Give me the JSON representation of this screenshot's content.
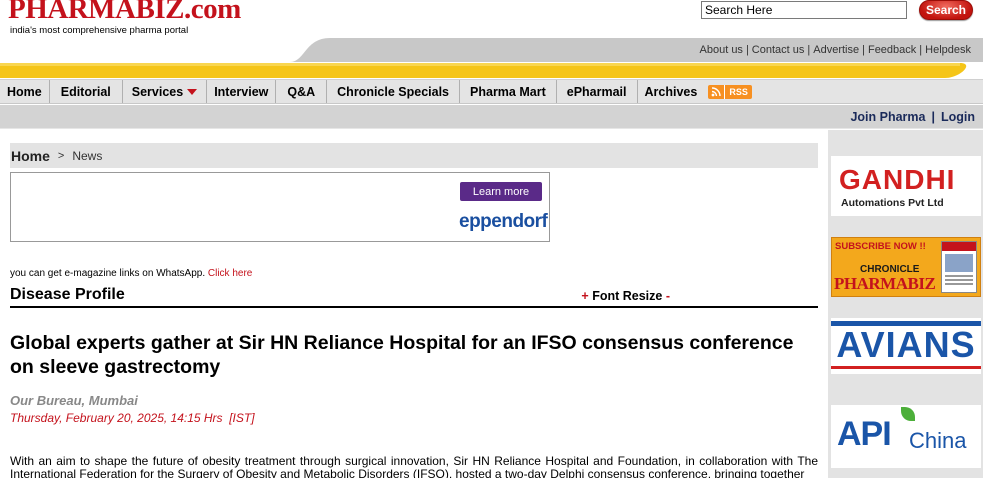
{
  "header": {
    "logo_text": "PHARMABIZ",
    "logo_dot": ".",
    "logo_suffix": "com",
    "tagline": "india's most comprehensive pharma portal",
    "search_value": "Search Here",
    "search_button": "Search"
  },
  "util_links": [
    "About us",
    "Contact us",
    "Advertise",
    "Feedback",
    "Helpdesk"
  ],
  "nav": {
    "items": [
      "Home",
      "Editorial",
      "Services",
      "Interview",
      "Q&A",
      "Chronicle Specials",
      "Pharma Mart",
      "ePharmail",
      "Archives"
    ],
    "rss": "RSS"
  },
  "account": {
    "join": "Join Pharma",
    "sep": "|",
    "login": "Login"
  },
  "breadcrumb": {
    "home": "Home",
    "sep": ">",
    "current": "News"
  },
  "ad": {
    "button": "Learn more",
    "brand": "eppendorf"
  },
  "whatsapp": {
    "text": "you can get e-magazine links on WhatsApp.",
    "link": "Click here"
  },
  "section": {
    "title": "Disease Profile",
    "plus": "+",
    "label": "Font Resize",
    "minus": "-"
  },
  "article": {
    "headline": "Global experts gather at Sir HN Reliance Hospital for an IFSO consensus conference on sleeve gastrectomy",
    "byline": "Our Bureau, Mumbai",
    "dateline": "Thursday, February 20, 2025, 14:15 Hrs  [IST]",
    "body": "With an aim to shape the future of obesity treatment through surgical innovation, Sir HN Reliance Hospital and Foundation, in collaboration with The International Federation for the Surgery of Obesity and Metabolic Disorders (IFSO), hosted a two-day Delphi consensus conference, bringing together"
  },
  "sidebar": {
    "gandhi_title": "GANDHI",
    "gandhi_sub": "Automations Pvt Ltd",
    "chronicle_line1": "SUBSCRIBE NOW !!",
    "chronicle_line2": "CHRONICLE",
    "chronicle_line3": "PHARMABIZ",
    "avians": "AVIANS",
    "api": "API",
    "china": "China"
  },
  "colors": {
    "brand_red": "#c4121c",
    "nav_bg": "#e4e4e4",
    "yellow": "#f5c518",
    "gray_bar": "#c8c8c8"
  }
}
